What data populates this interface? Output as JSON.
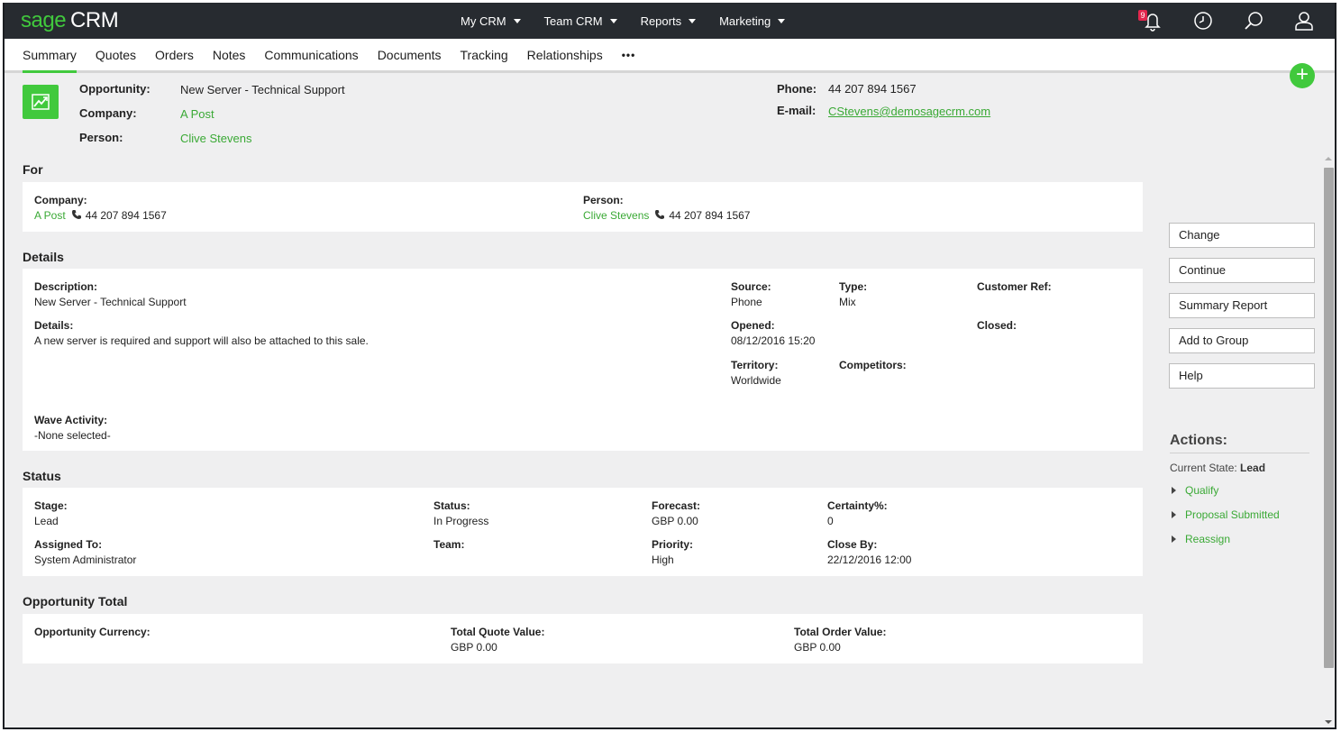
{
  "app": {
    "logo_sage": "sage",
    "logo_crm": "CRM",
    "nav": [
      "My CRM",
      "Team CRM",
      "Reports",
      "Marketing"
    ],
    "notification_count": "9",
    "icons": [
      "bell-icon",
      "clock-icon",
      "search-icon",
      "user-icon"
    ]
  },
  "tabs": [
    "Summary",
    "Quotes",
    "Orders",
    "Notes",
    "Communications",
    "Documents",
    "Tracking",
    "Relationships",
    "•••"
  ],
  "header": {
    "opportunity_label": "Opportunity:",
    "opportunity_value": "New Server - Technical Support",
    "company_label": "Company:",
    "company_value": "A Post",
    "person_label": "Person:",
    "person_value": "Clive Stevens",
    "phone_label": "Phone:",
    "phone_value": "44 207 894 1567",
    "email_label": "E-mail:",
    "email_value": "CStevens@demosagecrm.com"
  },
  "for_section": {
    "title": "For",
    "company_label": "Company:",
    "company_value": "A Post",
    "company_phone": "44 207 894 1567",
    "person_label": "Person:",
    "person_value": "Clive Stevens",
    "person_phone": "44 207 894 1567"
  },
  "details_section": {
    "title": "Details",
    "description_label": "Description:",
    "description_value": "New Server - Technical Support",
    "details_label": "Details:",
    "details_value": "A new server is required and support will also be attached to this sale.",
    "source_label": "Source:",
    "source_value": "Phone",
    "type_label": "Type:",
    "type_value": "Mix",
    "customer_ref_label": "Customer Ref:",
    "opened_label": "Opened:",
    "opened_value": "08/12/2016 15:20",
    "closed_label": "Closed:",
    "territory_label": "Territory:",
    "territory_value": "Worldwide",
    "competitors_label": "Competitors:",
    "wave_label": "Wave Activity:",
    "wave_value": "-None selected-"
  },
  "status_section": {
    "title": "Status",
    "stage_label": "Stage:",
    "stage_value": "Lead",
    "status_label": "Status:",
    "status_value": "In Progress",
    "forecast_label": "Forecast:",
    "forecast_value": "GBP 0.00",
    "certainty_label": "Certainty%:",
    "certainty_value": "0",
    "assigned_label": "Assigned To:",
    "assigned_value": "System Administrator",
    "team_label": "Team:",
    "priority_label": "Priority:",
    "priority_value": "High",
    "closeby_label": "Close By:",
    "closeby_value": "22/12/2016 12:00"
  },
  "total_section": {
    "title": "Opportunity Total",
    "currency_label": "Opportunity Currency:",
    "quote_label": "Total Quote Value:",
    "quote_value": "GBP 0.00",
    "order_label": "Total Order Value:",
    "order_value": "GBP 0.00"
  },
  "side_buttons": [
    "Change",
    "Continue",
    "Summary Report",
    "Add to Group",
    "Help"
  ],
  "actions": {
    "title": "Actions:",
    "current_state_label": "Current State:",
    "current_state_value": "Lead",
    "links": [
      "Qualify",
      "Proposal Submitted",
      "Reassign"
    ]
  },
  "colors": {
    "accent_green": "#41c93d",
    "link_green": "#3aa935",
    "topbar": "#272b30",
    "page_bg": "#efeff0",
    "badge_red": "#e2264d"
  }
}
